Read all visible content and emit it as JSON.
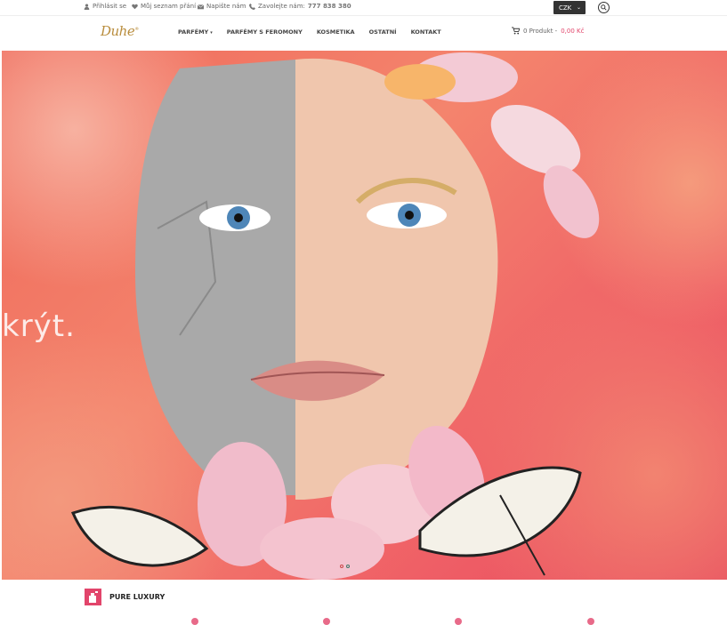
{
  "topbar": {
    "login": "Přihlásit se",
    "wishlist": "Můj seznam přání",
    "write": "Napište nám",
    "call_prefix": "Zavolejte nám:",
    "phone": "777 838 380",
    "currency": "CZK"
  },
  "brand": {
    "logo": "Duhe"
  },
  "nav": {
    "items": [
      {
        "label": "Parfémy"
      },
      {
        "label": "Parfémy s feromony"
      },
      {
        "label": "Kosmetika"
      },
      {
        "label": "Ostatní"
      },
      {
        "label": "Kontakt"
      }
    ]
  },
  "cart": {
    "count_label": "0 Produkt -",
    "price": "0,00 Kč"
  },
  "hero": {
    "text": "krýt."
  },
  "section": {
    "title": "Pure Luxury"
  },
  "colors": {
    "accent": "#e2456b",
    "brand": "#b98d3d"
  }
}
